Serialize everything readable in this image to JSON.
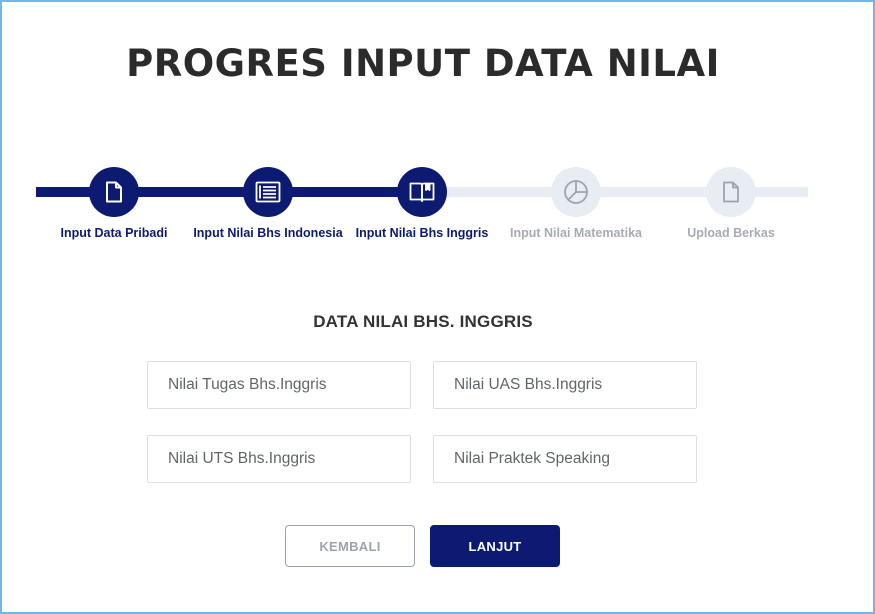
{
  "page": {
    "title": "PROGRES INPUT DATA NILAI"
  },
  "colors": {
    "primary": "#0c1a72",
    "inactive": "#e8edf3",
    "border": "#6fb6ea"
  },
  "steps": [
    {
      "label": "Input Data Pribadi",
      "icon": "document-icon",
      "status": "done"
    },
    {
      "label": "Input Nilai Bhs Indonesia",
      "icon": "list-document-icon",
      "status": "done"
    },
    {
      "label": "Input Nilai Bhs Inggris",
      "icon": "book-icon",
      "status": "done"
    },
    {
      "label": "Input Nilai Matematika",
      "icon": "pie-chart-icon",
      "status": "todo"
    },
    {
      "label": "Upload Berkas",
      "icon": "file-icon",
      "status": "todo"
    }
  ],
  "form": {
    "section_title": "DATA NILAI BHS. INGGRIS",
    "fields": [
      {
        "placeholder": "Nilai Tugas Bhs.Inggris",
        "value": ""
      },
      {
        "placeholder": "Nilai UAS Bhs.Inggris",
        "value": ""
      },
      {
        "placeholder": "Nilai UTS Bhs.Inggris",
        "value": ""
      },
      {
        "placeholder": "Nilai Praktek Speaking",
        "value": ""
      }
    ]
  },
  "buttons": {
    "back_label": "KEMBALI",
    "next_label": "LANJUT"
  }
}
